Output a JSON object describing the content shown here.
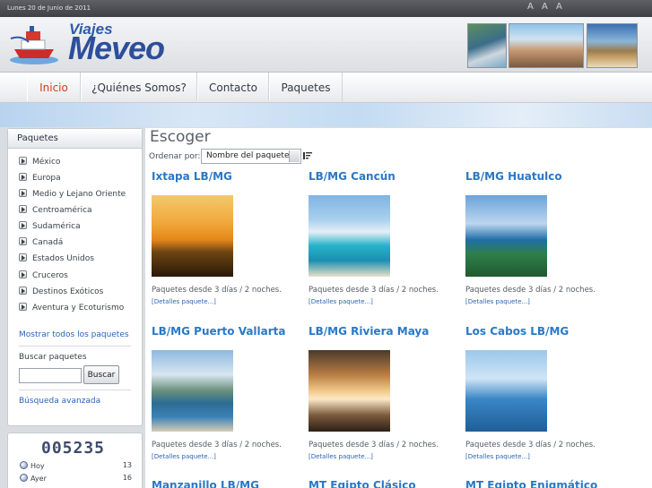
{
  "topbar": {
    "date": "Lunes 20 de Junio de 2011",
    "font_sizes": "A A A"
  },
  "logo": {
    "small": "Viajes",
    "big": "Meveo"
  },
  "nav": {
    "items": [
      {
        "label": "Inicio",
        "active": true
      },
      {
        "label": "¿Quiénes Somos?",
        "active": false
      },
      {
        "label": "Contacto",
        "active": false
      },
      {
        "label": "Paquetes",
        "active": false
      }
    ]
  },
  "sidebar": {
    "title": "Paquetes",
    "categories": [
      "México",
      "Europa",
      "Medio y Lejano Oriente",
      "Centroamérica",
      "Sudamérica",
      "Canadá",
      "Estados Unidos",
      "Cruceros",
      "Destinos Exóticos",
      "Aventura y Ecoturismo"
    ],
    "show_all": "Mostrar todos los paquetes",
    "search_label": "Buscar paquetes",
    "search_button": "Buscar",
    "advanced_search": "Búsqueda avanzada"
  },
  "counter": {
    "total": "005235",
    "rows": [
      {
        "label": "Hoy",
        "value": "13"
      },
      {
        "label": "Ayer",
        "value": "16"
      }
    ]
  },
  "main": {
    "title": "Escoger",
    "order_label": "Ordenar por:",
    "order_value": "Nombre del paquete",
    "packages": [
      {
        "title": "Ixtapa LB/MG",
        "image": "sunset-palms",
        "desc": "Paquetes desde 3 días / 2 noches.",
        "link": "[Detalles paquete...]"
      },
      {
        "title": "LB/MG Cancún",
        "image": "beach-hotels",
        "desc": "Paquetes desde 3 días / 2 noches.",
        "link": "[Detalles paquete...]"
      },
      {
        "title": "LB/MG Huatulco",
        "image": "bay-coast",
        "desc": "Paquetes desde 3 días / 2 noches.",
        "link": "[Detalles paquete...]"
      },
      {
        "title": "LB/MG Puerto Vallarta",
        "image": "bay-mountains",
        "desc": "Paquetes desde 3 días / 2 noches.",
        "link": "[Detalles paquete...]"
      },
      {
        "title": "LB/MG Riviera Maya",
        "image": "palm-roof",
        "desc": "Paquetes desde 3 días / 2 noches.",
        "link": "[Detalles paquete...]"
      },
      {
        "title": "Los Cabos LB/MG",
        "image": "whale",
        "desc": "Paquetes desde 3 días / 2 noches.",
        "link": "[Detalles paquete...]"
      },
      {
        "title": "Manzanillo LB/MG"
      },
      {
        "title": "MT Egipto Clásico"
      },
      {
        "title": "MT Egipto Enigmático"
      }
    ]
  },
  "colors": {
    "accent_link": "#2a78c6",
    "nav_active": "#d43a1a",
    "logo_blue": "#2c4e9b"
  }
}
